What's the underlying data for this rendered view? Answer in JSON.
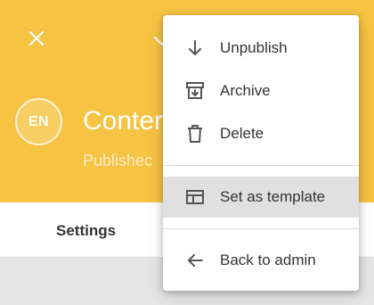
{
  "header": {
    "avatar_text": "EN",
    "title": "Conter",
    "subtitle": "Publishec",
    "color": "#f6c342"
  },
  "tabs": [
    {
      "label": "Settings"
    }
  ],
  "menu": {
    "items": [
      {
        "label": "Unpublish",
        "icon": "arrow-down-icon"
      },
      {
        "label": "Archive",
        "icon": "archive-icon"
      },
      {
        "label": "Delete",
        "icon": "trash-icon"
      },
      {
        "label": "Set as template",
        "icon": "template-icon",
        "highlighted": true
      },
      {
        "label": "Back to admin",
        "icon": "arrow-left-icon"
      }
    ]
  }
}
